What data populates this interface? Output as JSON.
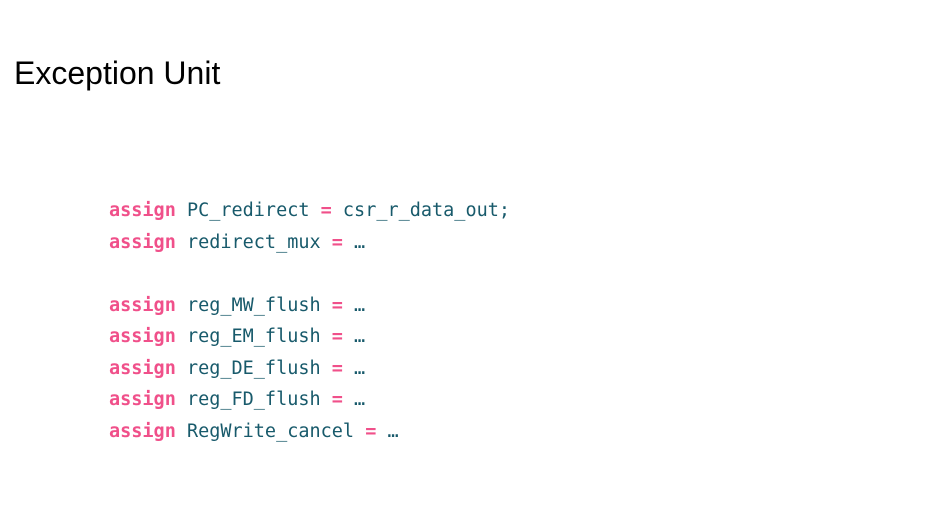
{
  "slide": {
    "title": "Exception Unit"
  },
  "code": {
    "lines": [
      {
        "keyword": "assign",
        "target": "PC_redirect",
        "op": "=",
        "rhs": "csr_r_data_out;"
      },
      {
        "keyword": "assign",
        "target": "redirect_mux",
        "op": "=",
        "rhs": "…"
      },
      null,
      {
        "keyword": "assign",
        "target": "reg_MW_flush",
        "op": "=",
        "rhs": "…"
      },
      {
        "keyword": "assign",
        "target": "reg_EM_flush",
        "op": "=",
        "rhs": "…"
      },
      {
        "keyword": "assign",
        "target": "reg_DE_flush",
        "op": "=",
        "rhs": "…"
      },
      {
        "keyword": "assign",
        "target": "reg_FD_flush",
        "op": "=",
        "rhs": "…"
      },
      {
        "keyword": "assign",
        "target": "RegWrite_cancel",
        "op": "=",
        "rhs": "…"
      }
    ]
  },
  "colors": {
    "keyword": "#f0508a",
    "identifier": "#185a6b",
    "title": "#000000",
    "background": "#ffffff"
  }
}
